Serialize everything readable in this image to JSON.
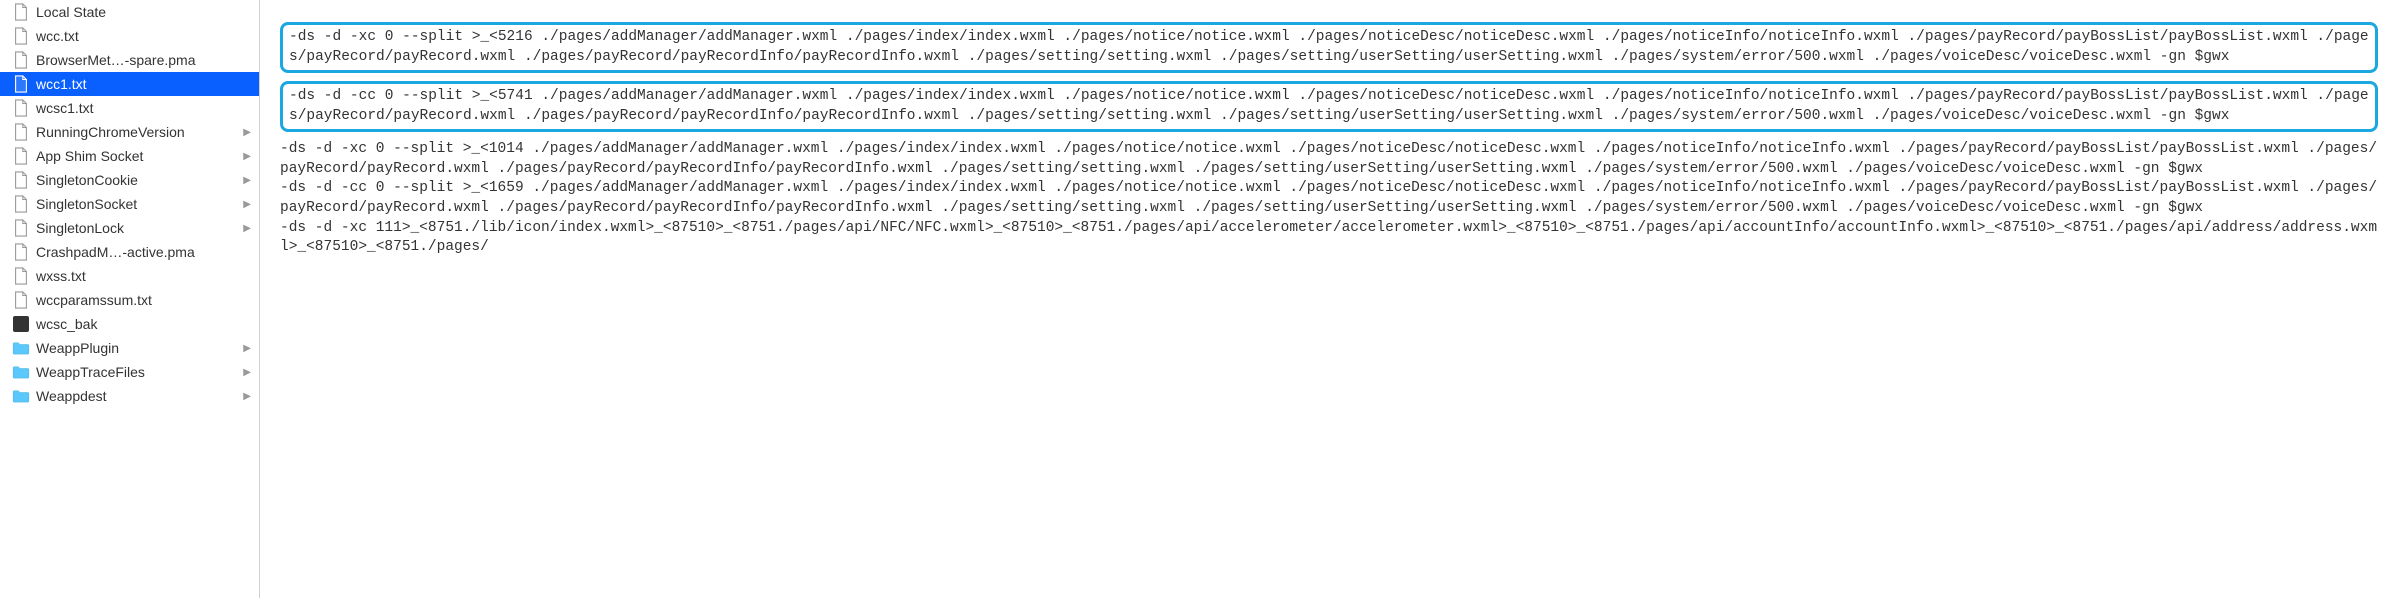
{
  "sidebar": {
    "items": [
      {
        "label": "Local State",
        "type": "file",
        "selected": false,
        "has_arrow": false
      },
      {
        "label": "wcc.txt",
        "type": "file",
        "selected": false,
        "has_arrow": false
      },
      {
        "label": "BrowserMet…-spare.pma",
        "type": "file",
        "selected": false,
        "has_arrow": false
      },
      {
        "label": "wcc1.txt",
        "type": "file",
        "selected": true,
        "has_arrow": false
      },
      {
        "label": "wcsc1.txt",
        "type": "file",
        "selected": false,
        "has_arrow": false
      },
      {
        "label": "RunningChromeVersion",
        "type": "file",
        "selected": false,
        "has_arrow": true
      },
      {
        "label": "App Shim Socket",
        "type": "file",
        "selected": false,
        "has_arrow": true
      },
      {
        "label": "SingletonCookie",
        "type": "file",
        "selected": false,
        "has_arrow": true
      },
      {
        "label": "SingletonSocket",
        "type": "file",
        "selected": false,
        "has_arrow": true
      },
      {
        "label": "SingletonLock",
        "type": "file",
        "selected": false,
        "has_arrow": true
      },
      {
        "label": "CrashpadM…-active.pma",
        "type": "file",
        "selected": false,
        "has_arrow": false
      },
      {
        "label": "wxss.txt",
        "type": "file",
        "selected": false,
        "has_arrow": false
      },
      {
        "label": "wccparamssum.txt",
        "type": "file",
        "selected": false,
        "has_arrow": false
      },
      {
        "label": "wcsc_bak",
        "type": "socket",
        "selected": false,
        "has_arrow": false
      },
      {
        "label": "WeappPlugin",
        "type": "folder",
        "selected": false,
        "has_arrow": true
      },
      {
        "label": "WeappTraceFiles",
        "type": "folder",
        "selected": false,
        "has_arrow": true
      },
      {
        "label": "Weappdest",
        "type": "folder",
        "selected": false,
        "has_arrow": true
      }
    ]
  },
  "content": {
    "block1": "-ds -d -xc 0 --split >_<5216 ./pages/addManager/addManager.wxml ./pages/index/index.wxml ./pages/notice/notice.wxml ./pages/noticeDesc/noticeDesc.wxml ./pages/noticeInfo/noticeInfo.wxml ./pages/payRecord/payBossList/payBossList.wxml ./pages/payRecord/payRecord.wxml ./pages/payRecord/payRecordInfo/payRecordInfo.wxml ./pages/setting/setting.wxml ./pages/setting/userSetting/userSetting.wxml ./pages/system/error/500.wxml ./pages/voiceDesc/voiceDesc.wxml -gn $gwx",
    "block2": "-ds -d -cc 0 --split >_<5741 ./pages/addManager/addManager.wxml ./pages/index/index.wxml ./pages/notice/notice.wxml ./pages/noticeDesc/noticeDesc.wxml ./pages/noticeInfo/noticeInfo.wxml ./pages/payRecord/payBossList/payBossList.wxml ./pages/payRecord/payRecord.wxml ./pages/payRecord/payRecordInfo/payRecordInfo.wxml ./pages/setting/setting.wxml ./pages/setting/userSetting/userSetting.wxml ./pages/system/error/500.wxml ./pages/voiceDesc/voiceDesc.wxml -gn $gwx",
    "block3": "-ds -d -xc 0 --split >_<1014 ./pages/addManager/addManager.wxml ./pages/index/index.wxml ./pages/notice/notice.wxml ./pages/noticeDesc/noticeDesc.wxml ./pages/noticeInfo/noticeInfo.wxml ./pages/payRecord/payBossList/payBossList.wxml ./pages/payRecord/payRecord.wxml ./pages/payRecord/payRecordInfo/payRecordInfo.wxml ./pages/setting/setting.wxml ./pages/setting/userSetting/userSetting.wxml ./pages/system/error/500.wxml ./pages/voiceDesc/voiceDesc.wxml -gn $gwx\n-ds -d -cc 0 --split >_<1659 ./pages/addManager/addManager.wxml ./pages/index/index.wxml ./pages/notice/notice.wxml ./pages/noticeDesc/noticeDesc.wxml ./pages/noticeInfo/noticeInfo.wxml ./pages/payRecord/payBossList/payBossList.wxml ./pages/payRecord/payRecord.wxml ./pages/payRecord/payRecordInfo/payRecordInfo.wxml ./pages/setting/setting.wxml ./pages/setting/userSetting/userSetting.wxml ./pages/system/error/500.wxml ./pages/voiceDesc/voiceDesc.wxml -gn $gwx\n-ds -d -xc 111>_<8751./lib/icon/index.wxml>_<87510>_<8751./pages/api/NFC/NFC.wxml>_<87510>_<8751./pages/api/accelerometer/accelerometer.wxml>_<87510>_<8751./pages/api/accountInfo/accountInfo.wxml>_<87510>_<8751./pages/api/address/address.wxml>_<87510>_<8751./pages/"
  }
}
